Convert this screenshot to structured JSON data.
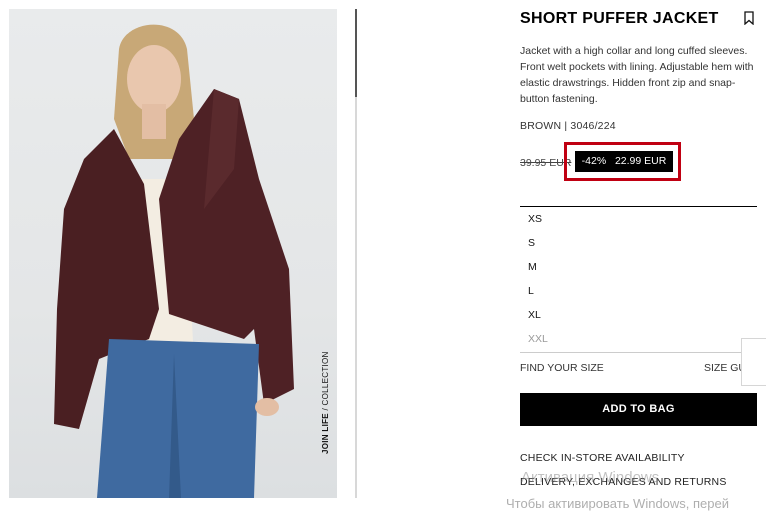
{
  "product": {
    "title": "SHORT PUFFER JACKET",
    "description": "Jacket with a high collar and long cuffed sleeves. Front welt pockets with lining. Adjustable hem with elastic drawstrings. Hidden front zip and snap-button fastening.",
    "color_ref": "BROWN | 3046/224",
    "old_price": "39.95 EUR",
    "discount": "-42%",
    "price": "22.99 EUR",
    "image_caption_bold": "JOIN LIFE",
    "image_caption_rest": " / COLLECTION"
  },
  "sizes": [
    {
      "label": "XS",
      "available": true
    },
    {
      "label": "S",
      "available": true
    },
    {
      "label": "M",
      "available": true
    },
    {
      "label": "L",
      "available": true
    },
    {
      "label": "XL",
      "available": true
    },
    {
      "label": "XXL",
      "available": false
    }
  ],
  "actions": {
    "find_size": "FIND YOUR SIZE",
    "size_guide": "SIZE GU",
    "add_to_bag": "ADD TO BAG",
    "store_availability": "CHECK IN-STORE AVAILABILITY",
    "delivery": "DELIVERY, EXCHANGES AND RETURNS"
  },
  "os_watermark": {
    "line1": "Активация Windows",
    "line2": "Чтобы активировать Windows, перей"
  },
  "colors": {
    "highlight_border": "#c00012",
    "jacket": "#4a1f22",
    "jeans": "#3f6aa0"
  },
  "icons": {
    "bookmark": "bookmark-icon"
  }
}
